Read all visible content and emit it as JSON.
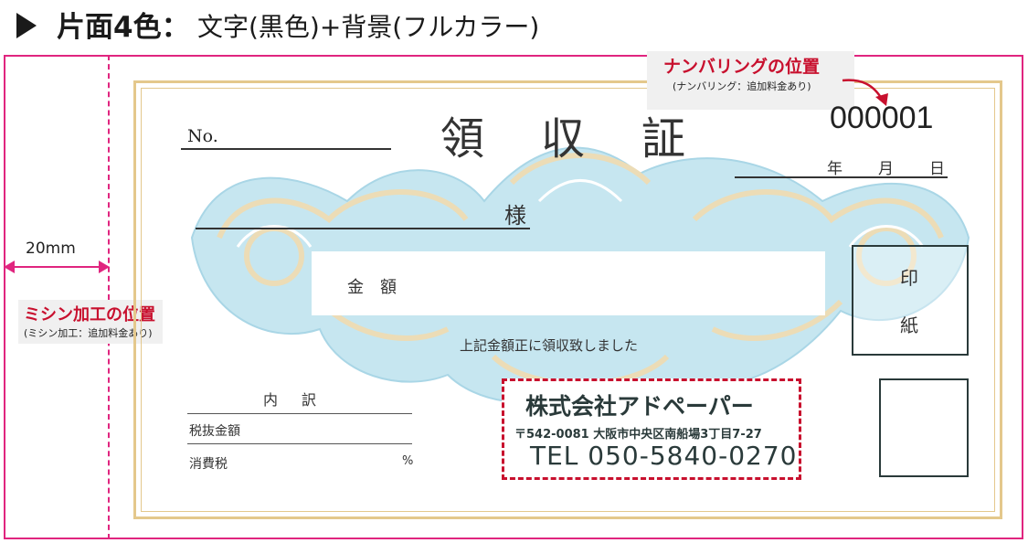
{
  "header": {
    "title": "片面4色：",
    "subtitle": "文字(黒色)+背景(フルカラー)"
  },
  "margin": {
    "dimension": "20mm",
    "perforation_label": "ミシン加工の位置",
    "perforation_note": "(ミシン加工：追加料金あり)"
  },
  "numbering": {
    "label": "ナンバリングの位置",
    "note": "(ナンバリング：追加料金あり)",
    "serial": "000001"
  },
  "receipt": {
    "no_label": "No.",
    "title": "領収証",
    "date": {
      "year": "年",
      "month": "月",
      "day": "日"
    },
    "addressee_suffix": "様",
    "amount_label": "金額",
    "received_text": "上記金額正に領収致しました",
    "stamp_line1": "印",
    "stamp_line2": "紙",
    "breakdown": {
      "heading": "内訳",
      "excl_tax": "税抜金額",
      "consumption_tax": "消費税",
      "percent": "%"
    }
  },
  "company": {
    "name": "株式会社アドペーパー",
    "address": "〒542-0081  大阪市中央区南船場3丁目7-27",
    "tel": "TEL  050-5840-0270"
  },
  "colors": {
    "accent_pink": "#e0257f",
    "accent_red": "#c8102e",
    "gold": "#e4c88c",
    "ornament_blue": "#bfe3ee"
  },
  "icons": [
    "play-arrow-icon",
    "curved-arrow-icon",
    "double-arrow-icon"
  ]
}
